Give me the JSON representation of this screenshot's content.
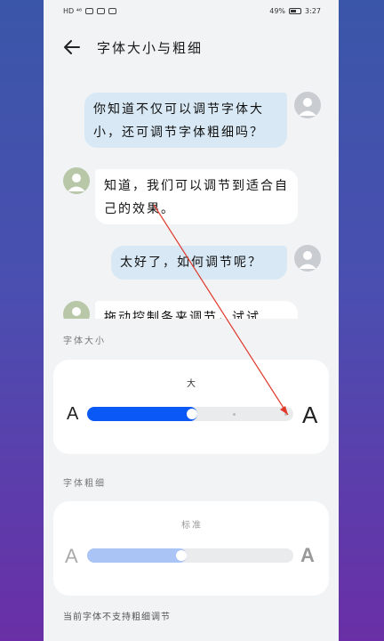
{
  "status_bar": {
    "left_indicators": "HD ⁴⁶",
    "battery_percent": "49%",
    "time": "3:27"
  },
  "header": {
    "title": "字体大小与粗细"
  },
  "chat": [
    {
      "sender": "me",
      "text": "你知道不仅可以调节字体大小，还可调节字体粗细吗？"
    },
    {
      "sender": "other",
      "text": "知道，我们可以调节到适合自己的效果。"
    },
    {
      "sender": "me",
      "text": "太好了，如何调节呢？"
    },
    {
      "sender": "other",
      "text": "拖动控制条来调节，试试"
    }
  ],
  "font_size": {
    "section_label": "字体大小",
    "level_label": "大",
    "small_letter": "A",
    "large_letter": "A",
    "level_index": 2,
    "level_count": 5,
    "accent_color": "#0a59f7"
  },
  "font_weight": {
    "section_label": "字体粗细",
    "level_label": "标准",
    "light_letter": "A",
    "bold_letter": "A",
    "fraction": 0.45,
    "accent_color": "#a9c4f5"
  },
  "note": "当前字体不支持粗细调节",
  "annotation_color": "#e0392b"
}
